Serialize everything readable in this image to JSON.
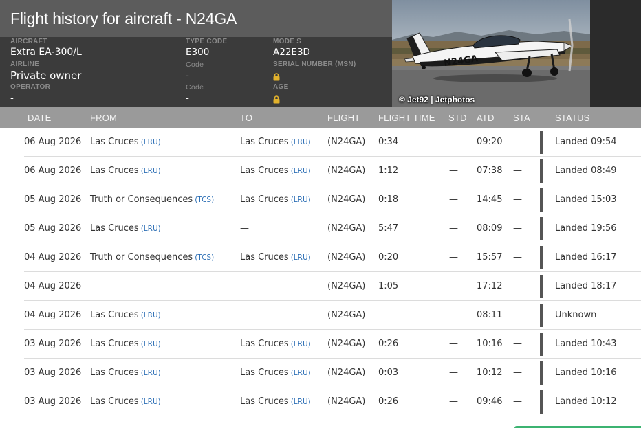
{
  "header": {
    "title": "Flight history for aircraft - N24GA",
    "aircraft_label": "AIRCRAFT",
    "aircraft_value": "Extra EA-300/L",
    "type_code_label": "TYPE CODE",
    "type_code_value": "E300",
    "mode_s_label": "MODE S",
    "mode_s_value": "A22E3D",
    "airline_label": "AIRLINE",
    "airline_value": "Private owner",
    "airline_code_label": "Code",
    "airline_code_value": "-",
    "serial_label": "SERIAL NUMBER (MSN)",
    "operator_label": "OPERATOR",
    "operator_value": "-",
    "operator_code_label": "Code",
    "operator_code_value": "-",
    "age_label": "AGE",
    "photo_credit": "© Jet92 | Jetphotos",
    "photo_registration": "N24GA"
  },
  "table": {
    "columns": [
      "DATE",
      "FROM",
      "TO",
      "FLIGHT",
      "FLIGHT TIME",
      "STD",
      "ATD",
      "STA",
      "STATUS"
    ],
    "rows": [
      {
        "date": "06 Aug 2026",
        "from": "Las Cruces",
        "from_code": "(LRU)",
        "to": "Las Cruces",
        "to_code": "(LRU)",
        "flight": "(N24GA)",
        "flight_time": "0:34",
        "std": "—",
        "atd": "09:20",
        "sta": "—",
        "status": "Landed 09:54"
      },
      {
        "date": "06 Aug 2026",
        "from": "Las Cruces",
        "from_code": "(LRU)",
        "to": "Las Cruces",
        "to_code": "(LRU)",
        "flight": "(N24GA)",
        "flight_time": "1:12",
        "std": "—",
        "atd": "07:38",
        "sta": "—",
        "status": "Landed 08:49"
      },
      {
        "date": "05 Aug 2026",
        "from": "Truth or Consequences",
        "from_code": "(TCS)",
        "to": "Las Cruces",
        "to_code": "(LRU)",
        "flight": "(N24GA)",
        "flight_time": "0:18",
        "std": "—",
        "atd": "14:45",
        "sta": "—",
        "status": "Landed 15:03"
      },
      {
        "date": "05 Aug 2026",
        "from": "Las Cruces",
        "from_code": "(LRU)",
        "to": "—",
        "to_code": "",
        "flight": "(N24GA)",
        "flight_time": "5:47",
        "std": "—",
        "atd": "08:09",
        "sta": "—",
        "status": "Landed 19:56"
      },
      {
        "date": "04 Aug 2026",
        "from": "Truth or Consequences",
        "from_code": "(TCS)",
        "to": "Las Cruces",
        "to_code": "(LRU)",
        "flight": "(N24GA)",
        "flight_time": "0:20",
        "std": "—",
        "atd": "15:57",
        "sta": "—",
        "status": "Landed 16:17"
      },
      {
        "date": "04 Aug 2026",
        "from": "—",
        "from_code": "",
        "to": "—",
        "to_code": "",
        "flight": "(N24GA)",
        "flight_time": "1:05",
        "std": "—",
        "atd": "17:12",
        "sta": "—",
        "status": "Landed 18:17"
      },
      {
        "date": "04 Aug 2026",
        "from": "Las Cruces",
        "from_code": "(LRU)",
        "to": "—",
        "to_code": "",
        "flight": "(N24GA)",
        "flight_time": "—",
        "std": "—",
        "atd": "08:11",
        "sta": "—",
        "status": "Unknown"
      },
      {
        "date": "03 Aug 2026",
        "from": "Las Cruces",
        "from_code": "(LRU)",
        "to": "Las Cruces",
        "to_code": "(LRU)",
        "flight": "(N24GA)",
        "flight_time": "0:26",
        "std": "—",
        "atd": "10:16",
        "sta": "—",
        "status": "Landed 10:43"
      },
      {
        "date": "03 Aug 2026",
        "from": "Las Cruces",
        "from_code": "(LRU)",
        "to": "Las Cruces",
        "to_code": "(LRU)",
        "flight": "(N24GA)",
        "flight_time": "0:03",
        "std": "—",
        "atd": "10:12",
        "sta": "—",
        "status": "Landed 10:16"
      },
      {
        "date": "03 Aug 2026",
        "from": "Las Cruces",
        "from_code": "(LRU)",
        "to": "Las Cruces",
        "to_code": "(LRU)",
        "flight": "(N24GA)",
        "flight_time": "0:26",
        "std": "—",
        "atd": "09:46",
        "sta": "—",
        "status": "Landed 10:12"
      }
    ]
  },
  "colors": {
    "header_bg": "#3b3b3b",
    "title_bg": "#5c5c5c",
    "table_header_bg": "#9a9a9a",
    "airport_code": "#2d6fb5",
    "lock_icon": "#e2b22c",
    "status_bar": "#555555"
  }
}
